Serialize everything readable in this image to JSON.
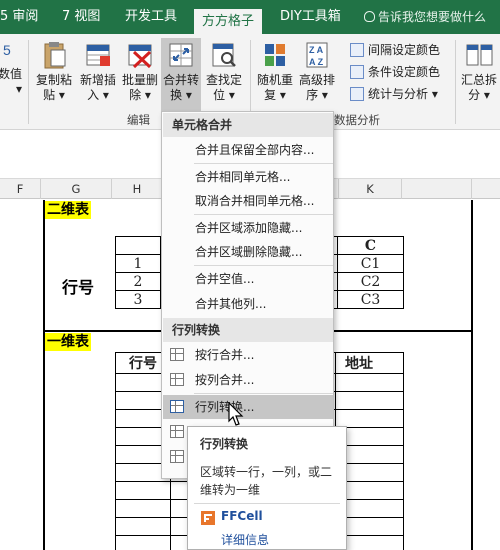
{
  "tabs": [
    {
      "label": "5 审阅"
    },
    {
      "label": "7 视图"
    },
    {
      "label": "开发工具"
    },
    {
      "label": "方方格子"
    },
    {
      "label": "DIY工具箱"
    }
  ],
  "tell_me": "告诉我您想要做什么",
  "ribbon": {
    "left_cut": {
      "line1": "5",
      "line2": "数值",
      "arrow": "▾"
    },
    "buttons": [
      {
        "line1": "复制粘",
        "line2": "贴 ▾"
      },
      {
        "line1": "新增插",
        "line2": "入 ▾"
      },
      {
        "line1": "批量删",
        "line2": "除 ▾"
      },
      {
        "line1": "合并转",
        "line2": "换 ▾"
      },
      {
        "line1": "查找定",
        "line2": "位 ▾"
      },
      {
        "line1": "随机重",
        "line2": "复 ▾"
      },
      {
        "line1": "高级排",
        "line2": "序 ▾"
      },
      {
        "line1": "汇总拆",
        "line2": "分 ▾"
      }
    ],
    "small": [
      {
        "label": "间隔设定颜色"
      },
      {
        "label": "条件设定颜色"
      },
      {
        "label": "统计与分析 ▾"
      }
    ],
    "groups": {
      "edit": "编辑",
      "analysis": "数据分析"
    }
  },
  "columns": [
    "F",
    "G",
    "H",
    "K"
  ],
  "sheet": {
    "section1": "二维表",
    "section2": "一维表",
    "row_label": "行号",
    "table1": {
      "header": "C",
      "rows": [
        {
          "num": "1",
          "val": "C1"
        },
        {
          "num": "2",
          "val": "C2"
        },
        {
          "num": "3",
          "val": "C3"
        }
      ]
    },
    "table2": {
      "h1": "行号",
      "h2": "地址"
    }
  },
  "menu": {
    "section1": "单元格合并",
    "items1": [
      "合并且保留全部内容...",
      "合并相同单元格...",
      "取消合并相同单元格...",
      "合并区域添加隐藏...",
      "合并区域删除隐藏...",
      "合并空值...",
      "合并其他列..."
    ],
    "section2": "行列转换",
    "items2": [
      "按行合并...",
      "按列合并...",
      "行列转换..."
    ]
  },
  "tooltip": {
    "title": "行列转换",
    "desc": "区域转一行，一列，或二维转为一维",
    "brand": "FFCell",
    "link": "详细信息"
  },
  "colors": {
    "accent": "#217346",
    "highlight": "#ffff00"
  }
}
